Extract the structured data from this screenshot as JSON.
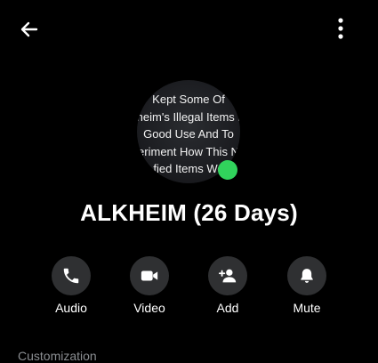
{
  "header": {
    "back_icon": "arrow-left-icon",
    "more_icon": "more-vertical-icon"
  },
  "profile": {
    "avatar_text_lines": [
      "Kept Some Of",
      "heim's Illegal Items i",
      "Good Use And To",
      "eriment How This N",
      "fied Items Wo"
    ],
    "online_color": "#31d35c",
    "name": "ALKHEIM (26 Days)"
  },
  "actions": [
    {
      "label": "Audio",
      "icon": "phone-icon"
    },
    {
      "label": "Video",
      "icon": "video-camera-icon"
    },
    {
      "label": "Add",
      "icon": "add-person-icon"
    },
    {
      "label": "Mute",
      "icon": "bell-icon"
    }
  ],
  "section": {
    "label": "Customization"
  },
  "colors": {
    "background": "#000000",
    "button_bg": "#2f3032",
    "secondary_text": "#8a8d91"
  }
}
